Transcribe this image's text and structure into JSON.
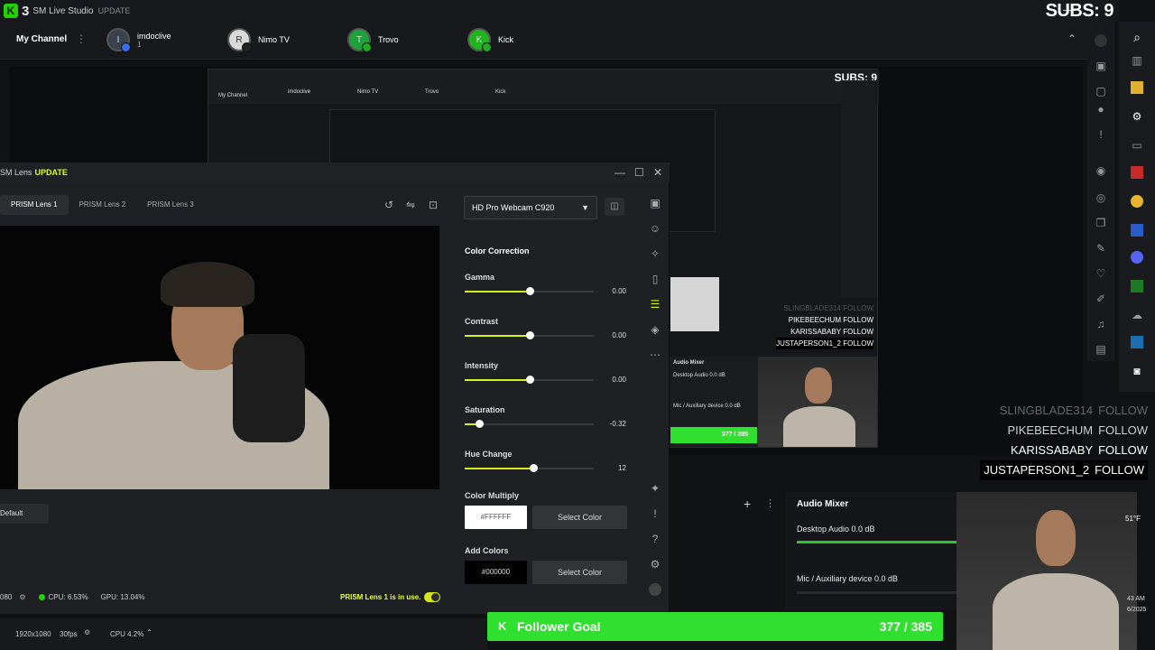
{
  "app": {
    "logo_letter": "K",
    "logo_num": "3",
    "title": "SM Live Studio",
    "update_label": "UPDATE",
    "subs": "SUBS: 9"
  },
  "channels": {
    "my_channel": "My Channel",
    "items": [
      {
        "name": "imdoclive",
        "sub": "1",
        "avatar": "I"
      },
      {
        "name": "Nimo TV",
        "sub": "",
        "avatar": "R"
      },
      {
        "name": "Trovo",
        "sub": "",
        "avatar": "T"
      },
      {
        "name": "Kick",
        "sub": "",
        "avatar": "K"
      }
    ]
  },
  "nested": {
    "my_channel": "My Channel",
    "channels": [
      "imdoclive",
      "Nimo TV",
      "Trovo",
      "Kick"
    ],
    "subs": "SUBS: 9",
    "audio_title": "Audio Mixer",
    "desktop": "Desktop Audio  0.0 dB",
    "mic": "Mic / Auxiliary device  0.0 dB",
    "goal": "377 / 385",
    "follows": [
      {
        "name": "SLINGBLADE314",
        "action": "FOLLOW"
      },
      {
        "name": "PIKEBEECHUM",
        "action": "FOLLOW"
      },
      {
        "name": "KARISSABABY",
        "action": "FOLLOW"
      },
      {
        "name": "JUSTAPERSON1_2",
        "action": "FOLLOW"
      }
    ]
  },
  "follows": [
    {
      "name": "SLINGBLADE314",
      "action": "FOLLOW"
    },
    {
      "name": "PIKEBEECHUM",
      "action": "FOLLOW"
    },
    {
      "name": "KARISSABABY",
      "action": "FOLLOW"
    },
    {
      "name": "JUSTAPERSON1_2",
      "action": "FOLLOW"
    }
  ],
  "audio_mixer": {
    "title": "Audio Mixer",
    "tracks": [
      {
        "label": "Desktop Audio  0.0 dB",
        "level": 0.98
      },
      {
        "label": "Mic / Auxiliary device  0.0 dB",
        "level": 0.0
      }
    ]
  },
  "weather": {
    "temp": "51°F"
  },
  "lens": {
    "title": "SM Lens",
    "update_label": "UPDATE",
    "tabs": [
      "PRISM Lens 1",
      "PRISM Lens 2",
      "PRISM Lens 3"
    ],
    "default_btn": "Default",
    "res": "080",
    "cpu": "CPU: 6.53%",
    "gpu": "GPU: 13.04%",
    "in_use": "PRISM Lens 1 is in use.",
    "camera": "HD Pro Webcam C920",
    "color_correction": "Color Correction",
    "sliders": [
      {
        "label": "Gamma",
        "value": "0.00",
        "pos": 0.5
      },
      {
        "label": "Contrast",
        "value": "0.00",
        "pos": 0.5
      },
      {
        "label": "Intensity",
        "value": "0.00",
        "pos": 0.5
      },
      {
        "label": "Saturation",
        "value": "-0.32",
        "pos": 0.11
      },
      {
        "label": "Hue Change",
        "value": "12",
        "pos": 0.53
      }
    ],
    "color_multiply": "Color Multiply",
    "multiply_hex": "#FFFFFF",
    "add_colors": "Add Colors",
    "add_hex": "#000000",
    "select_color": "Select Color"
  },
  "statusbar": {
    "resolution": "1920x1080",
    "fps": "30fps",
    "cpu": "CPU 4.2%"
  },
  "goal": {
    "label": "Follower Goal",
    "value": "377 / 385"
  },
  "clock": {
    "time": "43 AM",
    "date": "6/2025"
  },
  "colors": {
    "accent": "#d6f21f",
    "goal": "#2fe02f",
    "brand": "#1fd400"
  }
}
